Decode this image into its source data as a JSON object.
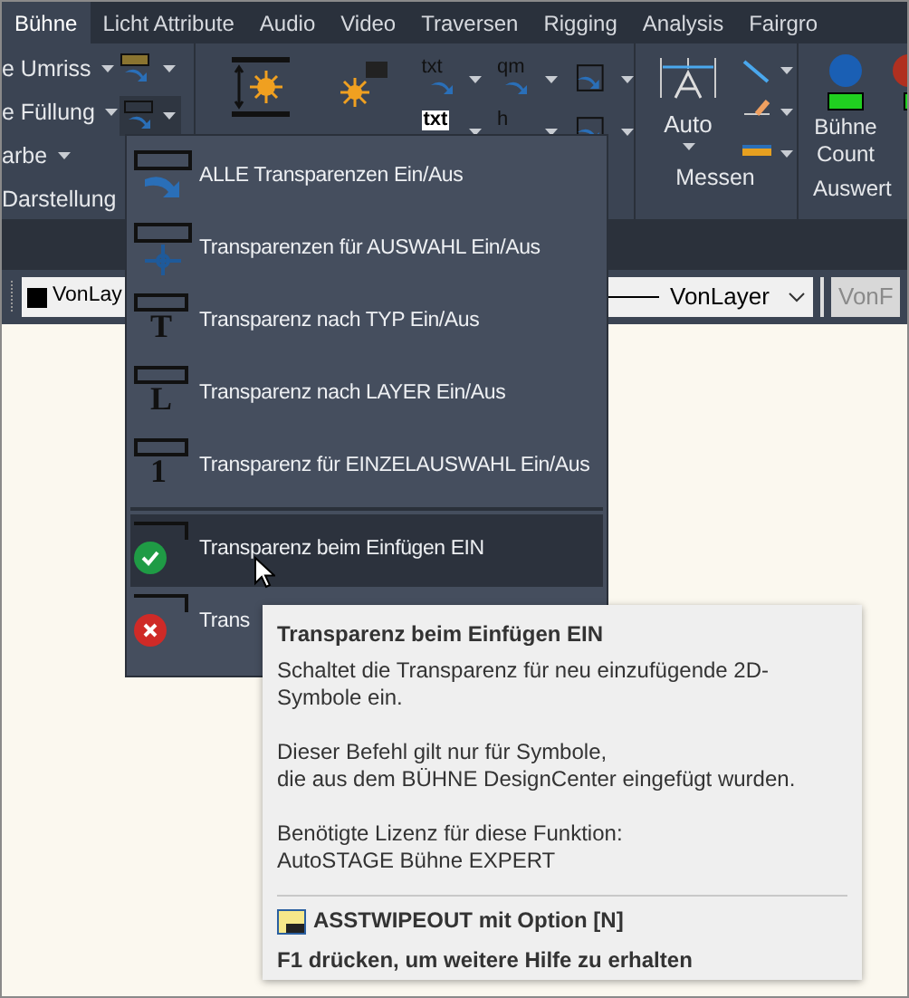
{
  "tabs": [
    {
      "label": "Bühne",
      "selected": true
    },
    {
      "label": "Licht Attribute",
      "selected": false
    },
    {
      "label": "Audio",
      "selected": false
    },
    {
      "label": "Video",
      "selected": false
    },
    {
      "label": "Traversen",
      "selected": false
    },
    {
      "label": "Rigging",
      "selected": false
    },
    {
      "label": "Analysis",
      "selected": false
    },
    {
      "label": "Fairgro",
      "selected": false
    }
  ],
  "ribbon": {
    "darstellung": {
      "items": [
        "e Umriss",
        "e Füllung",
        "arbe"
      ],
      "title": "Darstellung"
    },
    "small_labels": [
      "txt",
      "qm",
      "txt",
      "h"
    ],
    "messen": {
      "button": "Auto",
      "title": "Messen"
    },
    "auswertung": {
      "buttons": [
        "Bühne Count"
      ],
      "title": "Auswert"
    }
  },
  "properties": {
    "color_setting": "VonLay",
    "linetype": "VonLayer",
    "plotstyle": "VonF"
  },
  "menu": {
    "items": [
      {
        "label": "ALLE Transparenzen Ein/Aus",
        "kind": "arrow",
        "selected": false
      },
      {
        "label": "Transparenzen für AUSWAHL Ein/Aus",
        "kind": "crosshair",
        "selected": false
      },
      {
        "label": "Transparenz nach TYP Ein/Aus",
        "kind": "letter",
        "glyph": "T",
        "selected": false
      },
      {
        "label": "Transparenz nach LAYER Ein/Aus",
        "kind": "letter",
        "glyph": "L",
        "selected": false
      },
      {
        "label": "Transparenz für EINZELAUSWAHL Ein/Aus",
        "kind": "letter",
        "glyph": "1",
        "selected": false
      },
      {
        "label": "Transparenz beim Einfügen EIN",
        "kind": "status",
        "on": true,
        "selected": true,
        "separator_before": true
      },
      {
        "label": "Trans",
        "kind": "status",
        "on": false,
        "selected": false
      }
    ]
  },
  "tooltip": {
    "title": "Transparenz beim Einfügen EIN",
    "paragraphs": [
      "Schaltet die Transparenz für neu einzufügende 2D-Symbole ein.",
      "Dieser Befehl gilt nur für Symbole,\ndie aus dem BÜHNE DesignCenter eingefügt wurden.",
      "Benötigte Lizenz für diese Funktion:\nAutoSTAGE Bühne EXPERT"
    ],
    "command": "ASSTWIPEOUT mit Option [N]",
    "help": "F1 drücken, um weitere Hilfe zu erhalten"
  }
}
